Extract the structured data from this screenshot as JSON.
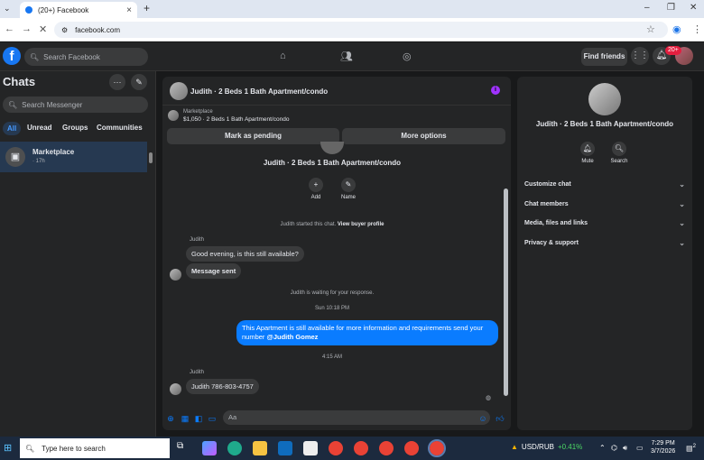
{
  "browser": {
    "tab_title": "(20+) Facebook",
    "url": "facebook.com"
  },
  "fb_header": {
    "search_placeholder": "Search Facebook",
    "find_friends": "Find friends",
    "notification_count": "20+"
  },
  "sidebar": {
    "title": "Chats",
    "search_placeholder": "Search Messenger",
    "filters": [
      "All",
      "Unread",
      "Groups",
      "Communities"
    ],
    "chat": {
      "name": "Marketplace",
      "time": "· 17h"
    }
  },
  "conversation": {
    "title": "Judith · 2 Beds 1 Bath Apartment/condo",
    "marketplace_label": "Marketplace",
    "listing": "$1,050 · 2 Beds 1 Bath Apartment/condo",
    "mark_pending": "Mark as pending",
    "more_options": "More options",
    "center_name": "Judith · 2 Beds 1 Bath Apartment/condo",
    "add_label": "Add",
    "name_label": "Name",
    "started_text": "Judith started this chat.",
    "view_profile": "View buyer profile",
    "sender1": "Judith",
    "msg1": "Good evening, is this still available?",
    "msg2": "Message sent",
    "waiting_text": "Judith is waiting for your response.",
    "time1": "Sun 10:18 PM",
    "out_msg_prefix": "This Apartment is still available for more information and requirements send your number ",
    "out_msg_mention": "@Judith Gomez",
    "time2": "4:15 AM",
    "sender2": "Judith",
    "msg3": "Judith 786-803-4757",
    "input_placeholder": "Aa"
  },
  "info_panel": {
    "name": "Judith · 2 Beds 1 Bath Apartment/condo",
    "mute": "Mute",
    "search": "Search",
    "sections": [
      "Customize chat",
      "Chat members",
      "Media, files and links",
      "Privacy & support"
    ]
  },
  "taskbar": {
    "search_placeholder": "Type here to search",
    "ticker_symbol": "USD/RUB",
    "ticker_change": "+0.41%",
    "time": "7:29 PM",
    "date": "3/7/2026",
    "notif_count": "2"
  },
  "colors": {
    "accent": "#0a7cff",
    "fb_blue": "#1877f2",
    "bg": "#18191a",
    "panel": "#242526"
  }
}
